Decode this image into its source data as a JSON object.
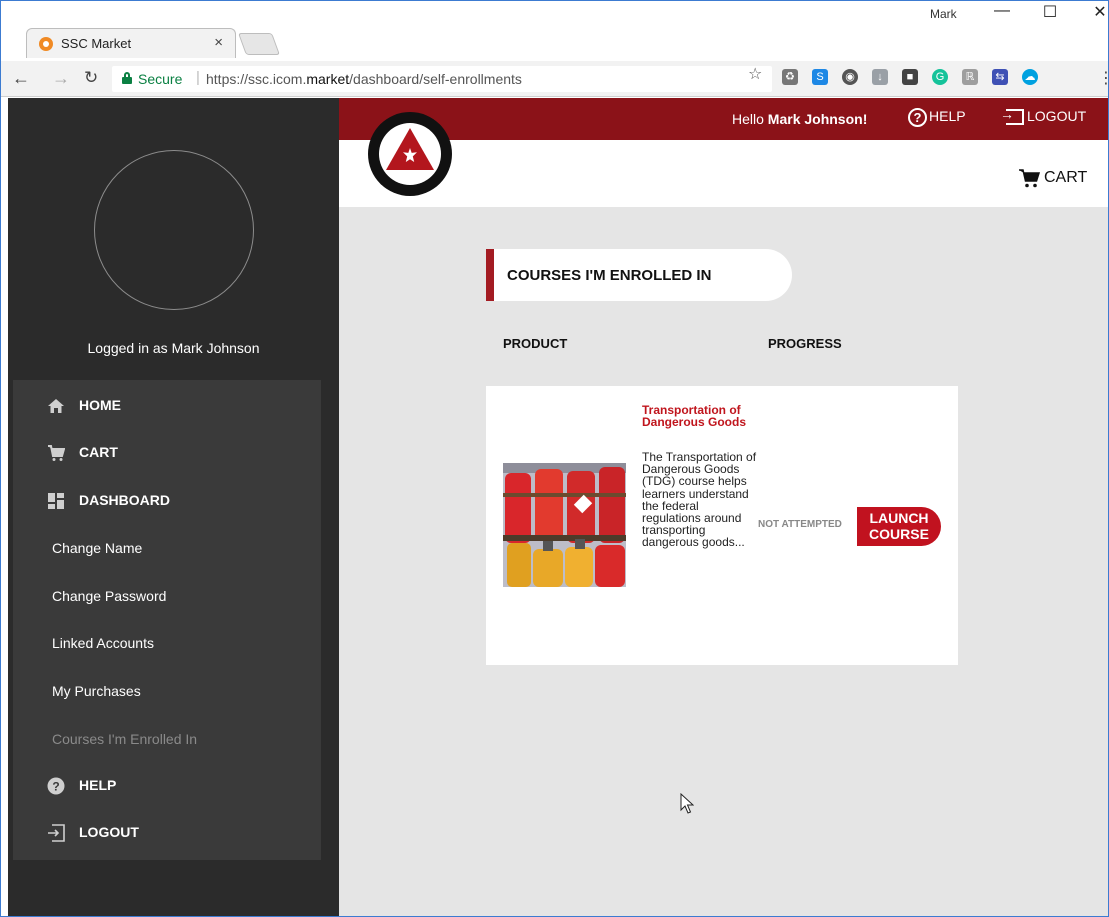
{
  "browser": {
    "tab_title": "SSC Market",
    "tab_close": "×",
    "window_user": "Mark",
    "secure_label": "Secure",
    "url_prefix": "https://ssc.icom.",
    "url_domain": "market",
    "url_path": "/dashboard/self-enrollments"
  },
  "header": {
    "hello_prefix": "Hello ",
    "hello_name": "Mark Johnson!",
    "help_label": "HELP",
    "logout_label": "LOGOUT",
    "cart_label": "CART"
  },
  "sidebar": {
    "logged_in": "Logged in as Mark Johnson",
    "items": [
      {
        "label": "HOME",
        "icon": "home-icon"
      },
      {
        "label": "CART",
        "icon": "cart-icon"
      },
      {
        "label": "DASHBOARD",
        "icon": "dashboard-icon"
      },
      {
        "label": "Change Name"
      },
      {
        "label": "Change Password"
      },
      {
        "label": "Linked Accounts"
      },
      {
        "label": "My Purchases"
      },
      {
        "label": "Courses I'm Enrolled In",
        "active": true
      },
      {
        "label": "HELP",
        "icon": "help-icon"
      },
      {
        "label": "LOGOUT",
        "icon": "logout-icon"
      }
    ]
  },
  "main": {
    "section_title": "COURSES I'M ENROLLED IN",
    "columns": [
      "PRODUCT",
      "PROGRESS"
    ],
    "course": {
      "title": "Transportation of Dangerous Goods",
      "description": "The Transportation of Dangerous Goods (TDG) course helps learners understand the federal regulations around transporting dangerous goods...",
      "status": "NOT ATTEMPTED",
      "button_label": "LAUNCH COURSE"
    }
  },
  "colors": {
    "brand_red": "#8b1218",
    "accent_red": "#c1121f",
    "sidebar_bg": "#2b2b2b",
    "main_bg": "#e5e5e5"
  }
}
